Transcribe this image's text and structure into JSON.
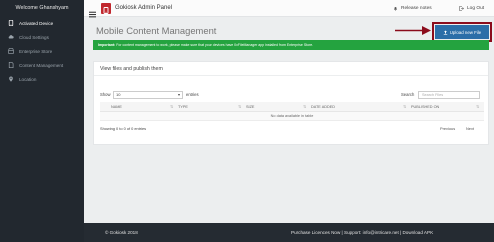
{
  "sidebar": {
    "welcome": "Welcome Ghanshyam",
    "items": [
      {
        "label": "Activated Device",
        "icon": "tablet-icon"
      },
      {
        "label": "Cloud Settings",
        "icon": "cloud-icon"
      },
      {
        "label": "Enterprise Store",
        "icon": "store-icon"
      },
      {
        "label": "Content Management",
        "icon": "file-icon"
      },
      {
        "label": "Location",
        "icon": "map-pin-icon"
      }
    ]
  },
  "header": {
    "title": "Gokiosk Admin Panel",
    "release_notes": "Release notes",
    "logout": "Log Out"
  },
  "main": {
    "page_title": "Mobile Content Management",
    "upload_label": "Upload new File",
    "alert_strong": "Important:",
    "alert_text": " For content management to work, please make sure that your devices have 0xFileManager app installed from Enterprise Store.",
    "panel_title": "View files and publish them",
    "show_label": "Show",
    "show_value": "10",
    "entries_label": "entries",
    "search_label": "Search",
    "search_placeholder": "Search Files",
    "columns": [
      "NAME",
      "TYPE",
      "SIZE",
      "DATE ADDED",
      "PUBLISHED ON"
    ],
    "empty_text": "No data available in table",
    "showing_text": "Showing 0 to 0 of 0 entries",
    "prev_label": "Previous",
    "next_label": "Next"
  },
  "footer": {
    "copyright": "© Gokiosk 2018",
    "links": "Purchase Licences Now | Support: info@intricare.net | Download APK"
  },
  "colors": {
    "sidebar_bg": "#22282f",
    "accent_blue": "#2b6ea8",
    "alert_green": "#24a33f",
    "highlight_red": "#8b0c1c"
  }
}
